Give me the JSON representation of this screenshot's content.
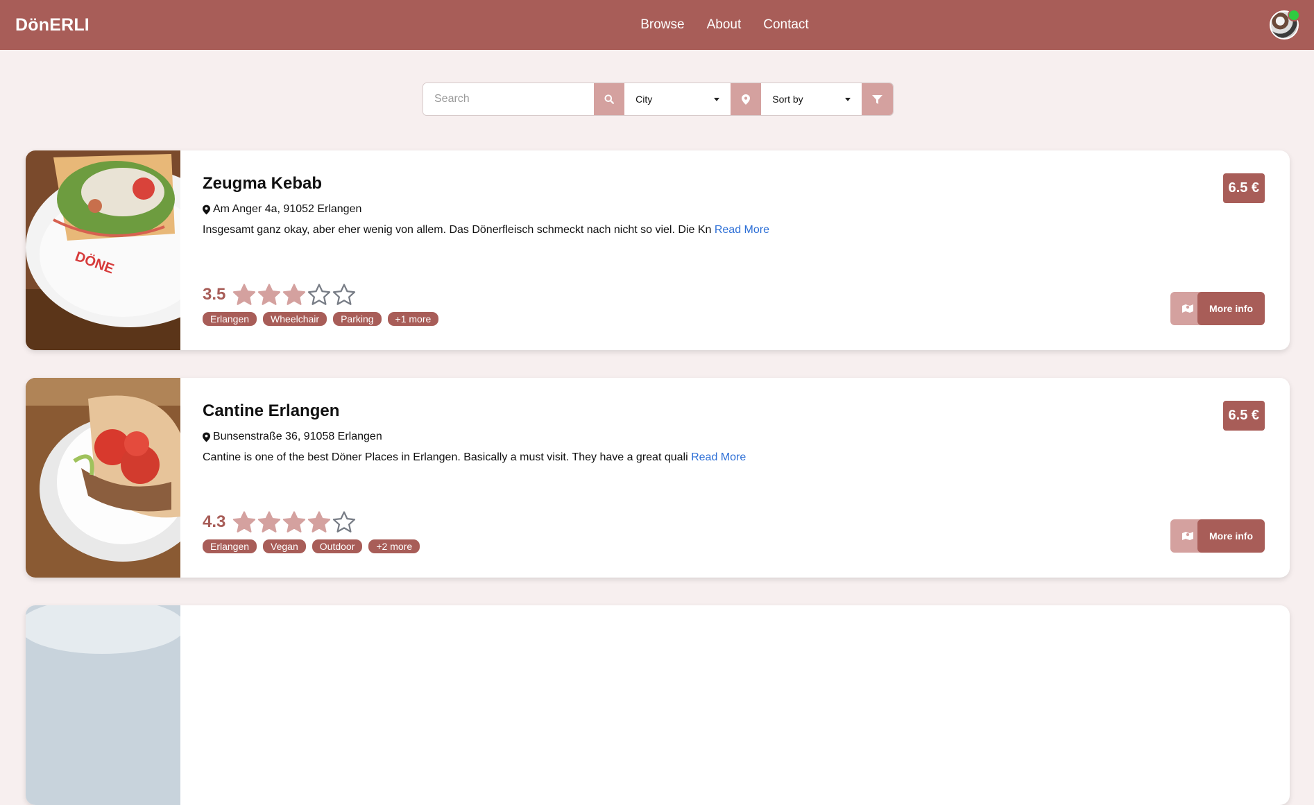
{
  "navbar": {
    "brand": "DönERLI",
    "links": [
      "Browse",
      "About",
      "Contact"
    ]
  },
  "filters": {
    "search_placeholder": "Search",
    "city_label": "City",
    "sort_label": "Sort by"
  },
  "colors": {
    "primary": "#a85d58",
    "secondary": "#d4a19f",
    "background": "#f7efef",
    "link": "#2d6fd6"
  },
  "icons": [
    "search-icon",
    "location-pin-icon",
    "filter-icon",
    "map-icon",
    "star-icon"
  ],
  "restaurants": [
    {
      "name": "Zeugma Kebab",
      "address": "Am Anger 4a, 91052 Erlangen",
      "description": "Insgesamt ganz okay, aber eher wenig von allem. Das Dönerfleisch schmeckt nach nicht so viel. Die Kn",
      "read_more": "Read More",
      "rating": 3.5,
      "rating_text": "3.5",
      "stars_filled": 3,
      "stars_total": 5,
      "tags": [
        "Erlangen",
        "Wheelchair",
        "Parking",
        "+1 more"
      ],
      "price": "6.5 €",
      "more_info": "More info"
    },
    {
      "name": "Cantine Erlangen",
      "address": "Bunsenstraße 36, 91058 Erlangen",
      "description": "Cantine is one of the best Döner Places in Erlangen. Basically a must visit. They have a great quali",
      "read_more": "Read More",
      "rating": 4.3,
      "rating_text": "4.3",
      "stars_filled": 4,
      "stars_total": 5,
      "tags": [
        "Erlangen",
        "Vegan",
        "Outdoor",
        "+2 more"
      ],
      "price": "6.5 €",
      "more_info": "More info"
    }
  ]
}
